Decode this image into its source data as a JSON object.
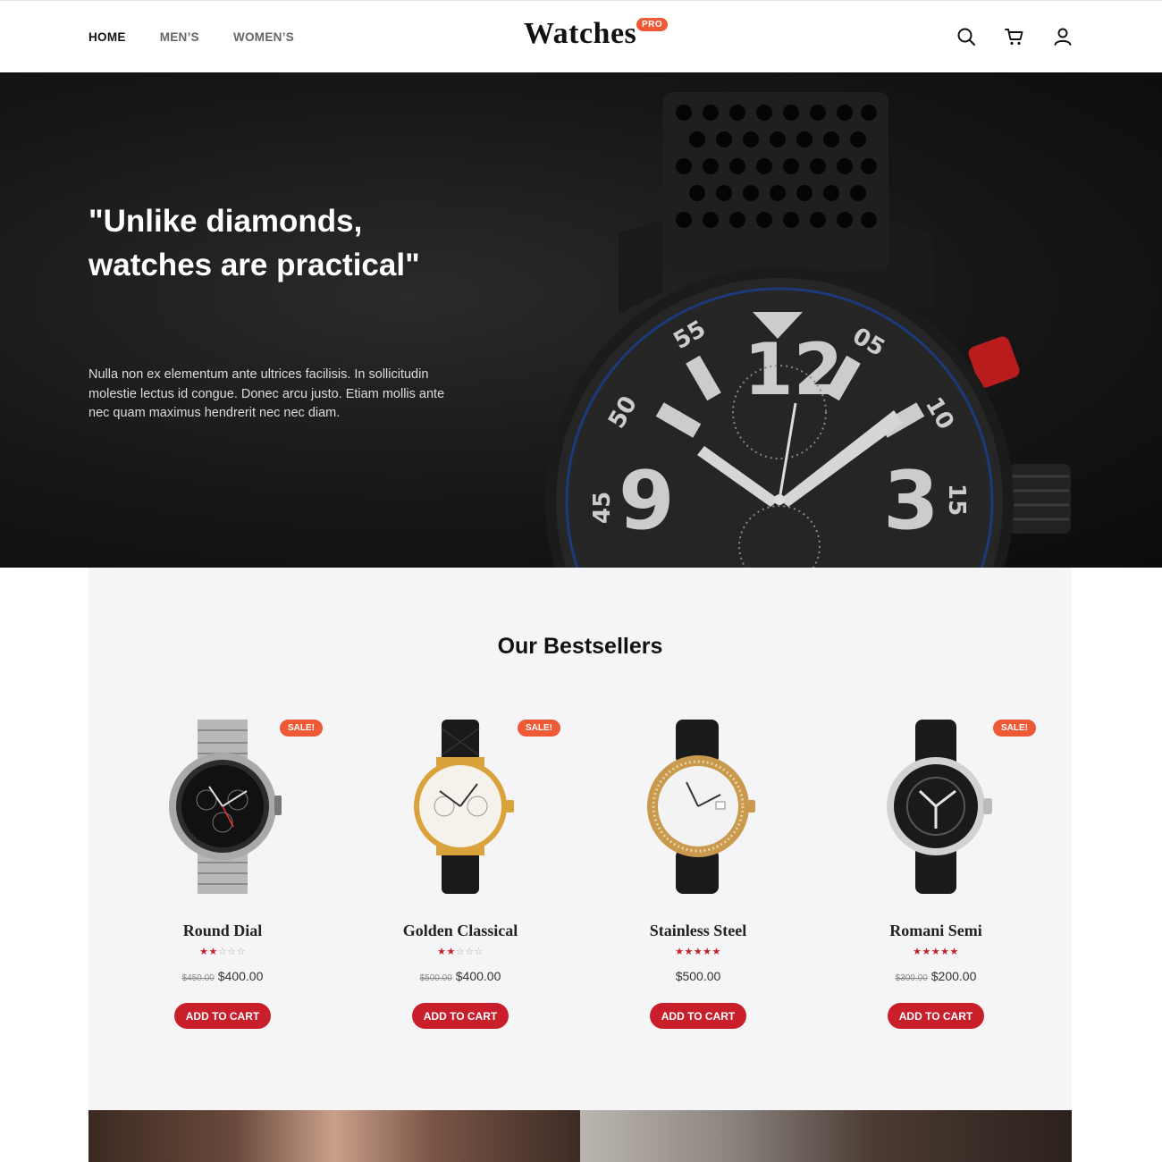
{
  "header": {
    "nav": [
      {
        "label": "HOME",
        "active": true
      },
      {
        "label": "MEN’S",
        "active": false
      },
      {
        "label": "WOMEN’S",
        "active": false
      }
    ],
    "logo_text": "Watches",
    "logo_badge": "PRO",
    "icons": [
      "search-icon",
      "cart-icon",
      "user-icon"
    ]
  },
  "hero": {
    "title": "\"Unlike diamonds, watches are practical\"",
    "text": "Nulla non ex elementum ante ultrices facilisis. In sollicitudin molestie lectus id congue. Donec arcu justo. Etiam mollis ante nec quam maximus hendrerit nec nec diam."
  },
  "bestsellers": {
    "title": "Our Bestsellers",
    "products": [
      {
        "name": "Round Dial",
        "rating": 2,
        "old_price": "$450.00",
        "price": "$400.00",
        "badge": "SALE!",
        "button": "ADD TO CART"
      },
      {
        "name": "Golden Classical",
        "rating": 2,
        "old_price": "$500.00",
        "price": "$400.00",
        "badge": "SALE!",
        "button": "ADD TO CART"
      },
      {
        "name": "Stainless Steel",
        "rating": 5,
        "old_price": "",
        "price": "$500.00",
        "badge": "",
        "button": "ADD TO CART"
      },
      {
        "name": "Romani Semi",
        "rating": 5,
        "old_price": "$300.00",
        "price": "$200.00",
        "badge": "SALE!",
        "button": "ADD TO CART"
      }
    ]
  },
  "colors": {
    "accent": "#c81f2b",
    "badge": "#ee5a36",
    "section_bg": "#f5f5f7"
  }
}
